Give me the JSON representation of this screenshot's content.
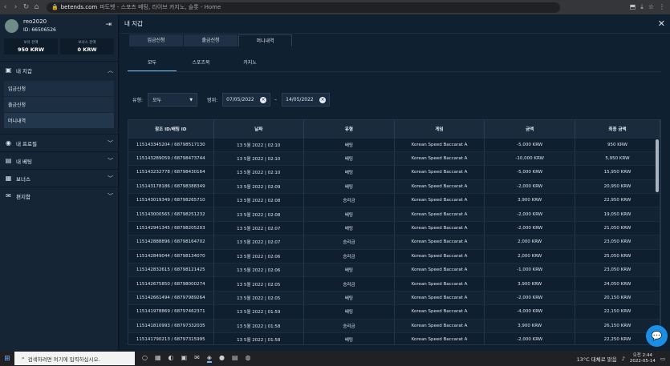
{
  "browser": {
    "url": "betends.com",
    "title": "파도벳 - 스포츠 베팅, 라이브 카지노, 슬롯 - Home"
  },
  "sidebar": {
    "username": "reo2020",
    "user_id": "ID: 66506526",
    "balances": [
      {
        "label": "보유 잔액",
        "value": "950 KRW"
      },
      {
        "label": "보너스 잔액",
        "value": "0 KRW"
      }
    ],
    "wallet_label": "내 지갑",
    "wallet_items": [
      "입금신청",
      "출금신청",
      "머니내역"
    ],
    "menu": [
      "내 프로필",
      "내 베팅",
      "보너스",
      "편지함"
    ]
  },
  "main": {
    "title": "내 지갑",
    "tabs": [
      "입금신청",
      "출금신청",
      "머니내역"
    ],
    "subtabs": [
      "모두",
      "스포츠북",
      "카지노"
    ],
    "filter": {
      "type_label": "유형:",
      "type_value": "모두",
      "range_label": "범위:",
      "date_from": "07/05/2022",
      "date_to": "14/05/2022",
      "dash": "–"
    },
    "table": {
      "headers": [
        "참조 ID/배팅 ID",
        "날짜",
        "유형",
        "게임",
        "금액",
        "최종 금액"
      ],
      "rows": [
        [
          "115143345204 / 68798517130",
          "13 5월 2022 | 02:10",
          "배팅",
          "Korean Speed Baccarat A",
          "-5,000 KRW",
          "950 KRW"
        ],
        [
          "115143289059 / 68798473744",
          "13 5월 2022 | 02:10",
          "배팅",
          "Korean Speed Baccarat A",
          "-10,000 KRW",
          "5,950 KRW"
        ],
        [
          "115143232778 / 68798430164",
          "13 5월 2022 | 02:10",
          "배팅",
          "Korean Speed Baccarat A",
          "-5,000 KRW",
          "15,950 KRW"
        ],
        [
          "115143178186 / 68798388349",
          "13 5월 2022 | 02:09",
          "배팅",
          "Korean Speed Baccarat A",
          "-2,000 KRW",
          "20,950 KRW"
        ],
        [
          "115143019349 / 68798265710",
          "13 5월 2022 | 02:08",
          "승리금",
          "Korean Speed Baccarat A",
          "3,900 KRW",
          "22,950 KRW"
        ],
        [
          "115143000565 / 68798251232",
          "13 5월 2022 | 02:08",
          "배팅",
          "Korean Speed Baccarat A",
          "-2,000 KRW",
          "19,050 KRW"
        ],
        [
          "115142941345 / 68798205203",
          "13 5월 2022 | 02:07",
          "배팅",
          "Korean Speed Baccarat A",
          "-2,000 KRW",
          "21,050 KRW"
        ],
        [
          "115142888896 / 68798164702",
          "13 5월 2022 | 02:07",
          "승리금",
          "Korean Speed Baccarat A",
          "2,000 KRW",
          "23,050 KRW"
        ],
        [
          "115142849044 / 68798134070",
          "13 5월 2022 | 02:06",
          "승리금",
          "Korean Speed Baccarat A",
          "2,000 KRW",
          "25,050 KRW"
        ],
        [
          "115142832615 / 68798121425",
          "13 5월 2022 | 02:06",
          "배팅",
          "Korean Speed Baccarat A",
          "-1,000 KRW",
          "23,050 KRW"
        ],
        [
          "115142675850 / 68798000274",
          "13 5월 2022 | 02:05",
          "승리금",
          "Korean Speed Baccarat A",
          "3,900 KRW",
          "24,050 KRW"
        ],
        [
          "115142661494 / 68797989264",
          "13 5월 2022 | 02:05",
          "배팅",
          "Korean Speed Baccarat A",
          "-2,000 KRW",
          "20,150 KRW"
        ],
        [
          "115141978869 / 68797462371",
          "13 5월 2022 | 01:59",
          "배팅",
          "Korean Speed Baccarat A",
          "-4,000 KRW",
          "22,150 KRW"
        ],
        [
          "115141810993 / 68797332035",
          "13 5월 2022 | 01:58",
          "승리금",
          "Korean Speed Baccarat A",
          "3,900 KRW",
          "26,150 KRW"
        ],
        [
          "115141790213 / 68797315995",
          "13 5월 2022 | 01:58",
          "배팅",
          "Korean Speed Baccarat A",
          "-2,000 KRW",
          "22,250 KRW"
        ]
      ]
    }
  },
  "taskbar": {
    "search_placeholder": "검색하려면 여기에 입력하십시오.",
    "weather": "13°C 대체로 맑음",
    "time": "오전 2:44",
    "date": "2022-05-14"
  }
}
